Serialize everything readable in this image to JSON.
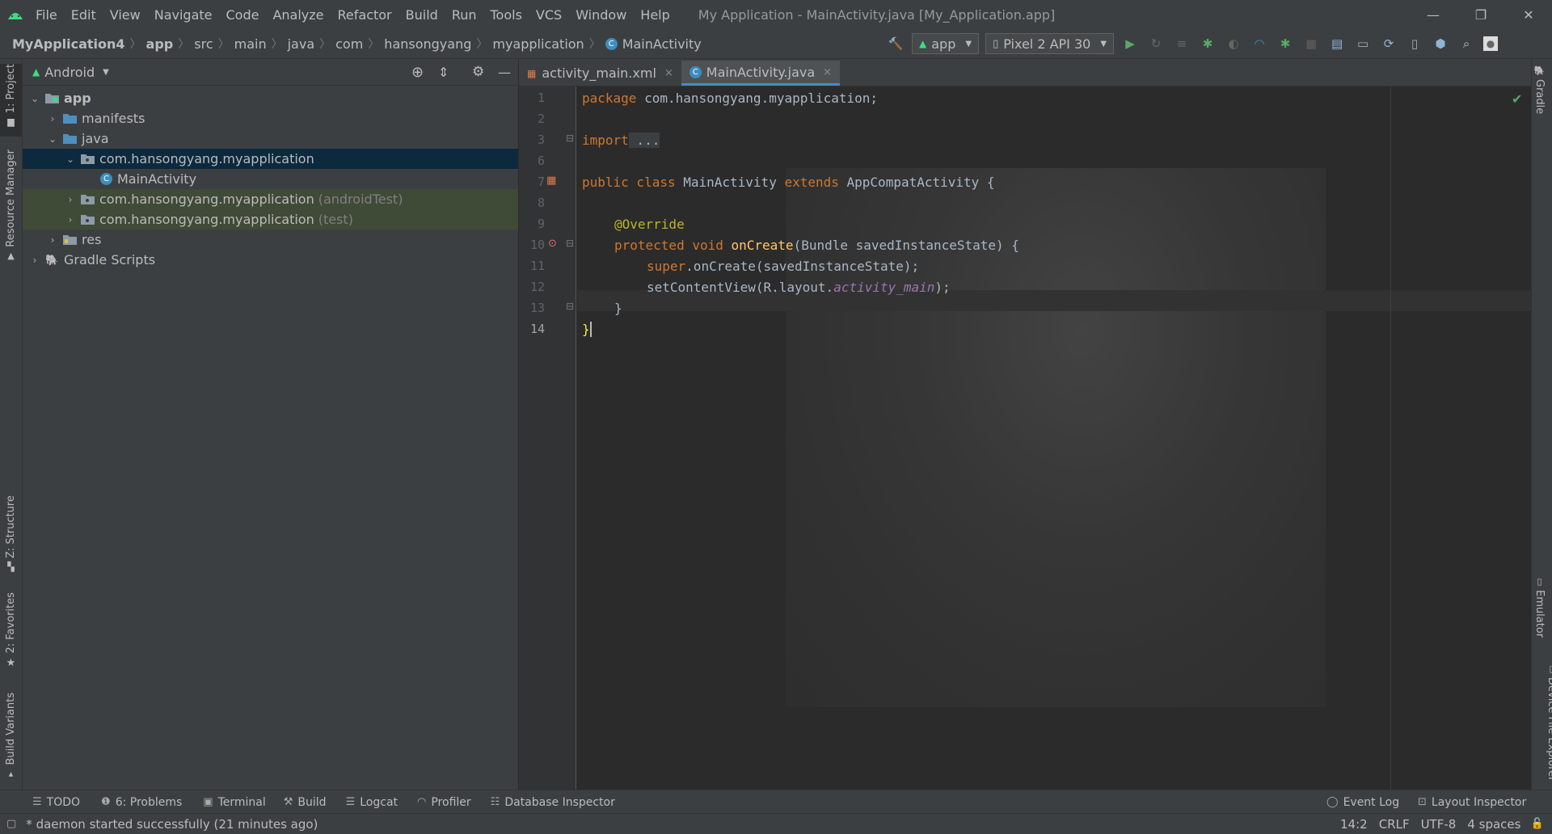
{
  "menu": {
    "items": [
      "File",
      "Edit",
      "View",
      "Navigate",
      "Code",
      "Analyze",
      "Refactor",
      "Build",
      "Run",
      "Tools",
      "VCS",
      "Window",
      "Help"
    ],
    "window_title": "My Application - MainActivity.java [My_Application.app]"
  },
  "window_controls": {
    "minimize": "—",
    "restore": "❐",
    "close": "✕"
  },
  "breadcrumb": {
    "items": [
      "MyApplication4",
      "app",
      "src",
      "main",
      "java",
      "com",
      "hansongyang",
      "myapplication",
      "MainActivity"
    ]
  },
  "toolbar": {
    "run_config": "app",
    "device": "Pixel 2 API 30"
  },
  "left_tabs": {
    "project": "1: Project",
    "resource_manager": "Resource Manager",
    "structure": "Z: Structure",
    "favorites": "2: Favorites",
    "build_variants": "Build Variants"
  },
  "right_tabs": {
    "gradle": "Gradle",
    "emulator": "Emulator",
    "device_file_explorer": "Device File Explorer"
  },
  "project_panel": {
    "view_mode": "Android",
    "tree": {
      "app": "app",
      "manifests": "manifests",
      "java": "java",
      "pkg_main": "com.hansongyang.myapplication",
      "main_activity": "MainActivity",
      "pkg_android_test": "com.hansongyang.myapplication",
      "pkg_android_test_suffix": "(androidTest)",
      "pkg_test": "com.hansongyang.myapplication",
      "pkg_test_suffix": "(test)",
      "res": "res",
      "gradle_scripts": "Gradle Scripts"
    }
  },
  "editor": {
    "tabs": [
      {
        "label": "activity_main.xml",
        "close": "×"
      },
      {
        "label": "MainActivity.java",
        "close": "×"
      }
    ],
    "line_numbers": [
      "1",
      "2",
      "3",
      "6",
      "7",
      "8",
      "9",
      "10",
      "11",
      "12",
      "13",
      "14"
    ],
    "code": {
      "l1_kw": "package",
      "l1_rest": " com.hansongyang.myapplication;",
      "l3_kw": "import",
      "l3_rest": " ...",
      "l7_kw": "public class",
      "l7_name": " MainActivity ",
      "l7_ext": "extends",
      "l7_rest": " AppCompatActivity {",
      "l9_ann": "@Override",
      "l10_kw": "protected void",
      "l10_fn": " onCreate",
      "l10_rest": "(Bundle savedInstanceState) {",
      "l11_kw": "super",
      "l11_rest": ".onCreate(savedInstanceState);",
      "l12_a": "setContentView(R.layout.",
      "l12_it": "activity_main",
      "l12_b": ");",
      "l13": "}",
      "l14": "}"
    }
  },
  "bottom_tools": {
    "todo": "TODO",
    "problems": "6: Problems",
    "terminal": "Terminal",
    "build": "Build",
    "logcat": "Logcat",
    "profiler": "Profiler",
    "database_inspector": "Database Inspector",
    "event_log": "Event Log",
    "layout_inspector": "Layout Inspector"
  },
  "status": {
    "message": "* daemon started successfully (21 minutes ago)",
    "position": "14:2",
    "line_sep": "CRLF",
    "encoding": "UTF-8",
    "indent": "4 spaces"
  },
  "colors": {
    "accent": "#4a88c7",
    "android_green": "#3ddc84",
    "keyword": "#cc7832",
    "annotation": "#bbb529",
    "function": "#ffc66d"
  }
}
